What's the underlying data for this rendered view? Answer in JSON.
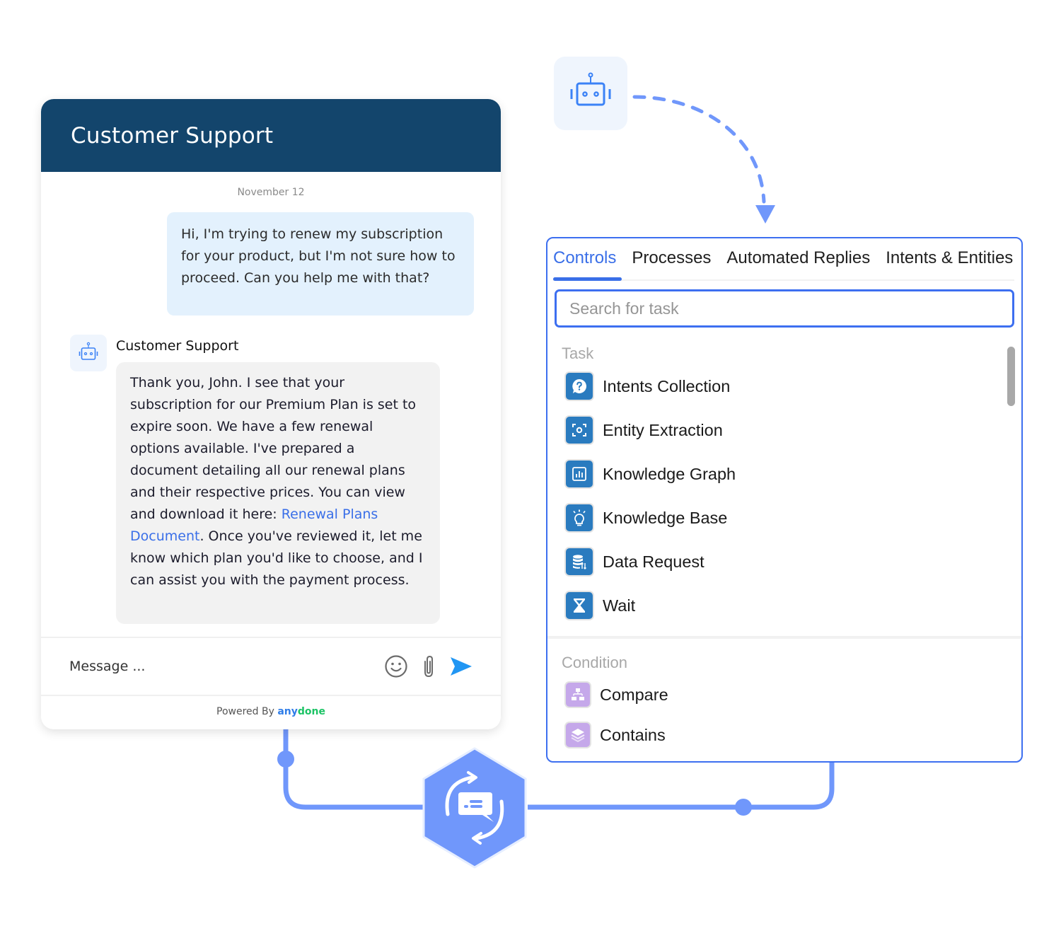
{
  "chat": {
    "title": "Customer Support",
    "date": "November 12",
    "user_message": "Hi, I'm trying to renew my subscription for your product, but I'm not sure how to proceed. Can you help me with that?",
    "bot_name": "Customer Support",
    "bot_message_before_link": "Thank you, John. I see that your subscription for our Premium Plan is set to expire soon. We have a few renewal options available. I've prepared a document detailing all our renewal plans and their respective prices. You can view and download it here: ",
    "bot_message_link": "Renewal Plans Document",
    "bot_message_after_link": ". Once you've reviewed it, let me know which plan you'd like to choose, and I can assist you with the payment process.",
    "composer_placeholder": "Message ...",
    "composer_icons": [
      "emoji-icon",
      "paperclip-icon",
      "send-icon"
    ],
    "powered_by": "Powered By ",
    "brand_part1": "any",
    "brand_part2": "done"
  },
  "panel": {
    "tabs": [
      {
        "label": "Controls",
        "active": true
      },
      {
        "label": "Processes",
        "active": false
      },
      {
        "label": "Automated Replies",
        "active": false
      },
      {
        "label": "Intents & Entities",
        "active": false
      }
    ],
    "search_placeholder": "Search for task",
    "task_section": "Task",
    "tasks": [
      {
        "label": "Intents Collection",
        "icon": "question-bubble-icon"
      },
      {
        "label": "Entity Extraction",
        "icon": "scan-focus-icon"
      },
      {
        "label": "Knowledge Graph",
        "icon": "bar-chart-icon"
      },
      {
        "label": "Knowledge Base",
        "icon": "lightbulb-icon"
      },
      {
        "label": "Data Request",
        "icon": "database-transfer-icon"
      },
      {
        "label": "Wait",
        "icon": "hourglass-icon"
      }
    ],
    "condition_section": "Condition",
    "conditions": [
      {
        "label": "Compare",
        "icon": "hierarchy-icon"
      },
      {
        "label": "Contains",
        "icon": "layers-icon"
      }
    ]
  },
  "colors": {
    "header_bg": "#13456c",
    "accent": "#3a6fe8",
    "connector": "#7097fb",
    "task_icon_bg": "#2a7bbf",
    "condition_icon_bg": "#c5a8ea",
    "user_bubble": "#e3f1fd",
    "bot_bubble": "#f2f2f2",
    "brand_blue": "#2f7de8",
    "brand_green": "#1cc365"
  }
}
